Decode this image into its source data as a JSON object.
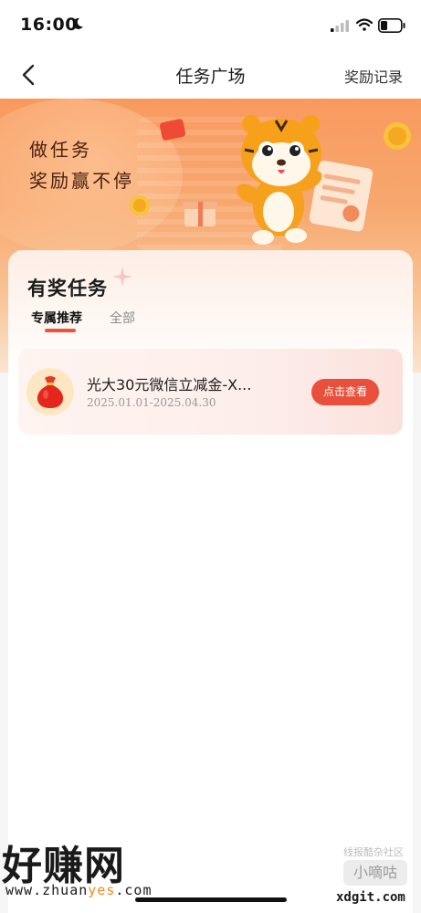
{
  "status_bar": {
    "time": "16:00"
  },
  "nav": {
    "title": "任务广场",
    "right_label": "奖励记录"
  },
  "banner": {
    "line1": "做任务",
    "line2": "奖励赢不停"
  },
  "section": {
    "title": "有奖任务",
    "tabs": [
      {
        "label": "专属推荐",
        "active": true
      },
      {
        "label": "全部",
        "active": false
      }
    ]
  },
  "tasks": [
    {
      "title": "光大30元微信立减金-X...",
      "date_range": "2025.01.01-2025.04.30",
      "button_label": "点击查看",
      "icon": "red-bag-icon"
    }
  ],
  "watermark": {
    "brand_text": "好赚网",
    "url_prefix": "www.zhuan",
    "url_highlight": "yes",
    "url_suffix": ".com",
    "small_text": "线报酷杂社区",
    "badge_text": "小嘀咕",
    "domain": "xdgit.com"
  },
  "colors": {
    "accent": "#e9503b",
    "banner_top": "#f89a5f",
    "tab_underline": "#ef5335"
  }
}
